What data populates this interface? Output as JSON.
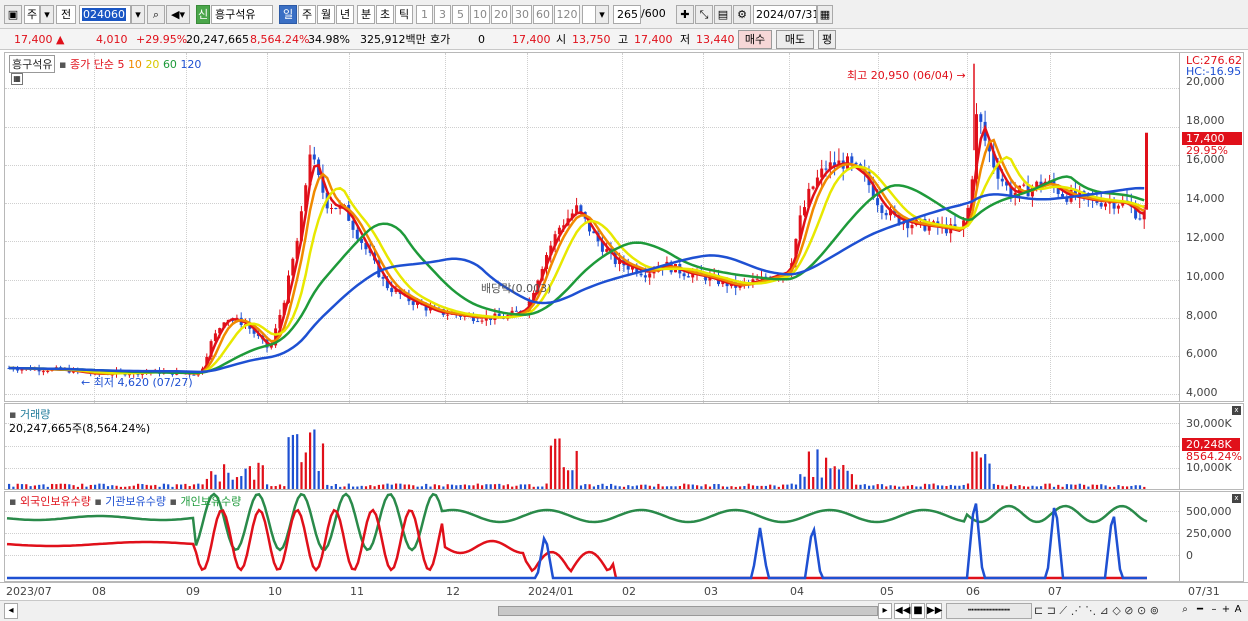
{
  "toolbar": {
    "market_a": "주",
    "market_b": "전",
    "stock_code": "024060",
    "credit_badge": "신",
    "stock_name": "흥구석유",
    "periods": [
      "일",
      "주",
      "월",
      "년",
      "분",
      "초",
      "틱"
    ],
    "active_period": "일",
    "intervals": [
      "1",
      "3",
      "5",
      "10",
      "20",
      "30",
      "60",
      "120"
    ],
    "count_value": "265",
    "count_max": "/600",
    "date_value": "2024/07/31"
  },
  "quote": {
    "price": "17,400",
    "change": "4,010",
    "change_pct": "+29.95%",
    "volume": "20,247,665",
    "volume_pct": "8,564.24%",
    "turnover": "34.98%",
    "amount": "325,912백만",
    "hoga_label": "호가",
    "hoga_value": "0",
    "current": "17,400",
    "open_label": "시",
    "open_value": "13,750",
    "high_label": "고",
    "high_value": "17,400",
    "low_label": "저",
    "low_value": "13,440",
    "buy_label": "매수",
    "sell_label": "매도",
    "avg_label": "평"
  },
  "price_panel": {
    "stock_label": "흥구석유",
    "ma_label": "종가 단순",
    "ma_periods": [
      "5",
      "10",
      "20",
      "60",
      "120"
    ],
    "ma_colors": [
      "#e0101a",
      "#f08a00",
      "#e8e800",
      "#1e9a3a",
      "#1e50d2"
    ],
    "lc": "LC:276.62",
    "hc": "HC:-16.95",
    "price_tag": "17,400",
    "price_pct": "29.95%",
    "max_annotation": "최고 20,950 (06/04)",
    "min_annotation": "최저 4,620 (07/27)",
    "dividend_annotation": "배당락(0.003)"
  },
  "volume_panel": {
    "title": "거래량",
    "value_text": "20,247,665주(8,564.24%)",
    "tag": "20,248K",
    "tag_pct": "8564.24%",
    "ticks": [
      "30,000K",
      "10,000K"
    ]
  },
  "holding_panel": {
    "foreign": "외국인보유수량",
    "institution": "기관보유수량",
    "individual": "개인보유수량",
    "ticks": [
      "500,000",
      "250,000",
      "0"
    ]
  },
  "x_axis": [
    "2023/07",
    "08",
    "09",
    "10",
    "11",
    "12",
    "2024/01",
    "02",
    "03",
    "04",
    "05",
    "06",
    "07",
    "07/31"
  ],
  "chart_data": {
    "type": "candlestick",
    "y_ticks": [
      4000,
      6000,
      8000,
      10000,
      12000,
      14000,
      16000,
      18000,
      20000
    ],
    "ylim": [
      3500,
      21500
    ],
    "close_trajectory": [
      {
        "x": "2023/07",
        "close": 5300
      },
      {
        "x": "08",
        "close": 5000
      },
      {
        "x": "09",
        "close": 7400
      },
      {
        "x": "10",
        "close": 15500
      },
      {
        "x": "11",
        "close": 8500
      },
      {
        "x": "12",
        "close": 7800
      },
      {
        "x": "2024/01",
        "close": 13000
      },
      {
        "x": "02",
        "close": 10000
      },
      {
        "x": "03",
        "close": 9500
      },
      {
        "x": "04",
        "close": 15500
      },
      {
        "x": "05",
        "close": 12500
      },
      {
        "x": "06",
        "close": 16500
      },
      {
        "x": "07",
        "close": 14000
      },
      {
        "x": "07/31",
        "close": 17400
      }
    ],
    "high": 20950,
    "low": 4620,
    "last": 17400
  }
}
